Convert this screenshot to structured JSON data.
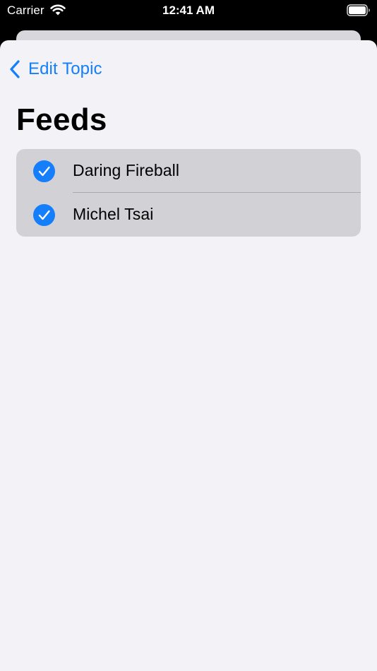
{
  "status_bar": {
    "carrier": "Carrier",
    "time": "12:41 AM",
    "wifi_icon": "wifi-icon",
    "battery_icon": "battery-full-icon",
    "text_color": "#ffffff"
  },
  "nav": {
    "back_label": "Edit Topic",
    "back_icon": "chevron-left-icon",
    "accent_color": "#147efb"
  },
  "page": {
    "title": "Feeds",
    "background": "#f2f2f7"
  },
  "feeds": [
    {
      "name": "Daring Fireball",
      "selected": true,
      "icon": "checkmark-circle-icon"
    },
    {
      "name": "Michel Tsai",
      "selected": true,
      "icon": "checkmark-circle-icon"
    }
  ]
}
